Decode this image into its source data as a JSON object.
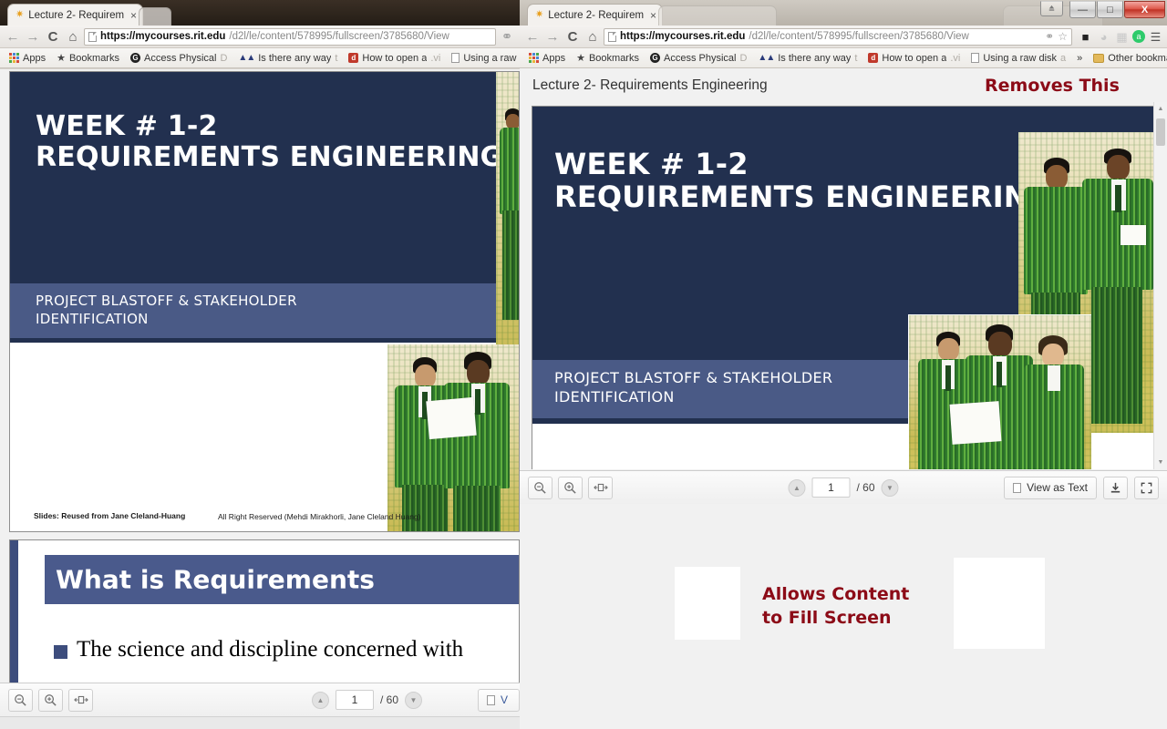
{
  "window_left": {
    "tab": {
      "title": "Lecture 2- Requirem",
      "close": "×",
      "star_icon": "star-icon"
    },
    "nav": {
      "back": "←",
      "forward": "→",
      "reload": "C",
      "home": "⌂"
    },
    "omnibox": {
      "host": "https://mycourses.rit.edu",
      "path": "/d2l/le/content/578995/fullscreen/3785680/View"
    },
    "bookmarks": [
      {
        "label": "Apps",
        "icon": "apps-grid-icon"
      },
      {
        "label": "Bookmarks",
        "icon": "star-icon"
      },
      {
        "label": "Access Physical",
        "trail": "D",
        "icon": "circle-g-icon"
      },
      {
        "label": "Is there any way",
        "trail": "t",
        "icon": "monogram-icon"
      },
      {
        "label": "How to open a",
        "trail": ".vi",
        "icon": "red-square-icon"
      },
      {
        "label": "Using a raw disk",
        "trail": "",
        "icon": "document-icon"
      }
    ],
    "slide1": {
      "title_line1": "WEEK # 1-2",
      "title_line2": "REQUIREMENTS ENGINEERING",
      "band_line1": "PROJECT BLASTOFF & STAKEHOLDER",
      "band_line2": "IDENTIFICATION",
      "footer_left": "Slides: Reused from Jane Cleland-Huang",
      "footer_right": "All Right Reserved (Mehdi Mirakhorli, Jane Cleland Huang)"
    },
    "slide2": {
      "title": "What is Requirements",
      "bullet1": "The science and discipline concerned with"
    },
    "toolbar": {
      "zoom_out": "zoom-out-icon",
      "zoom_in": "zoom-in-icon",
      "fit_width": "fit-width-icon",
      "page_up": "▲",
      "page_down": "▼",
      "page_value": "1",
      "page_total": "/ 60",
      "view_as_text": "V"
    }
  },
  "window_right": {
    "tab": {
      "title": "Lecture 2- Requirem",
      "close": "×",
      "star_icon": "star-icon"
    },
    "tab_ghost_title": "",
    "winbuttons": {
      "minimize": "—",
      "maximize": "□",
      "close": "X"
    },
    "nav": {
      "back": "←",
      "forward": "→",
      "reload": "C",
      "home": "⌂"
    },
    "omnibox": {
      "host": "https://mycourses.rit.edu",
      "path": "/d2l/le/content/578995/fullscreen/3785680/View",
      "shield_icon": "shield-icon",
      "bookmark_star_icon": "star-outline-icon"
    },
    "extensions": [
      {
        "icon": "black-square-icon"
      },
      {
        "icon": "ghost-icon"
      },
      {
        "icon": "chart-icon"
      },
      {
        "icon": "green-circle-icon"
      },
      {
        "icon": "chrome-menu-icon"
      }
    ],
    "bookmarks": [
      {
        "label": "Apps",
        "icon": "apps-grid-icon"
      },
      {
        "label": "Bookmarks",
        "icon": "star-icon"
      },
      {
        "label": "Access Physical",
        "trail": "D",
        "icon": "circle-g-icon"
      },
      {
        "label": "Is there any way",
        "trail": "t",
        "icon": "monogram-icon"
      },
      {
        "label": "How to open a",
        "trail": ".vi",
        "icon": "red-square-icon"
      },
      {
        "label": "Using a raw disk",
        "trail": "a",
        "icon": "document-icon"
      },
      {
        "label": "»",
        "icon": "overflow-icon"
      },
      {
        "label": "Other bookmarks",
        "icon": "folder-icon"
      }
    ],
    "document_title": "Lecture 2- Requirements Engineering",
    "slide1": {
      "title_line1": "WEEK # 1-2",
      "title_line2": "REQUIREMENTS ENGINEERING",
      "band_line1": "PROJECT BLASTOFF & STAKEHOLDER",
      "band_line2": "IDENTIFICATION"
    },
    "toolbar": {
      "zoom_out": "zoom-out-icon",
      "zoom_in": "zoom-in-icon",
      "fit_width": "fit-width-icon",
      "page_up": "▲",
      "page_down": "▼",
      "page_value": "1",
      "page_total": "/ 60",
      "view_as_text": "View as Text",
      "download": "download-icon",
      "fullscreen": "fullscreen-icon"
    }
  },
  "annotations": {
    "top": "Removes This",
    "bottom_line1": "Allows Content",
    "bottom_line2": "to Fill Screen",
    "color": "#8c0b17"
  }
}
